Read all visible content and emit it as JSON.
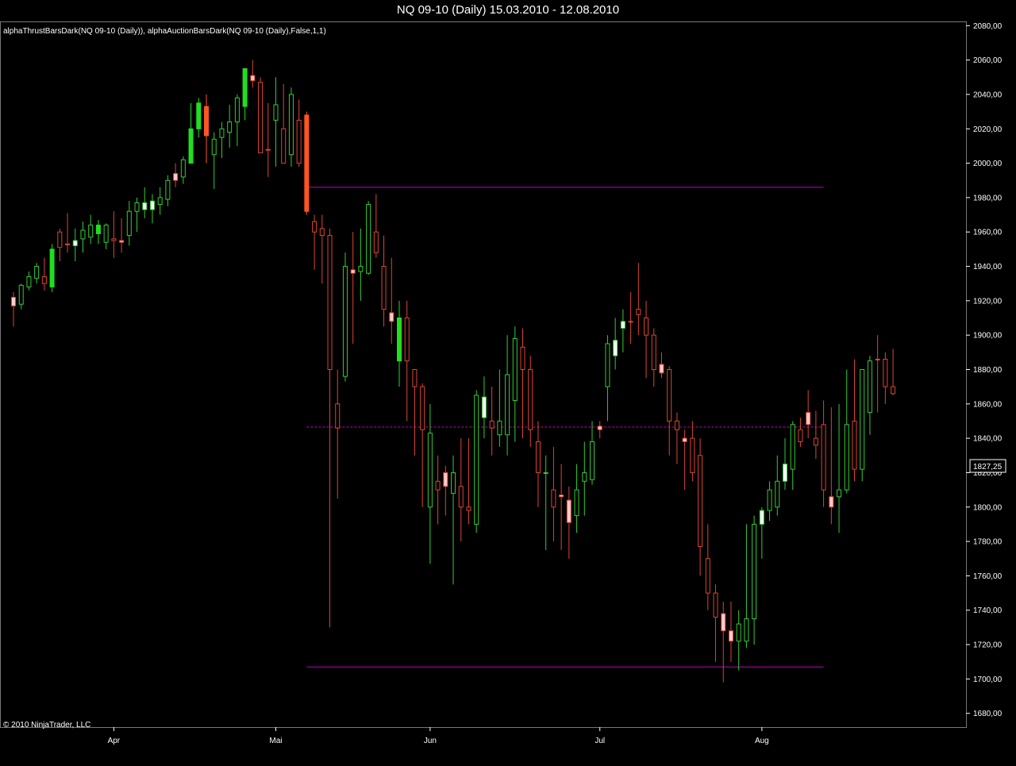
{
  "window": {
    "title": "NQ 09-10 (Daily)  15.03.2010 - 12.08.2010"
  },
  "chart_data": {
    "type": "candlestick",
    "indicator_label": "alphaThrustBarsDark(NQ 09-10 (Daily)), alphaAuctionBarsDark(NQ 09-10 (Daily),False,1,1)",
    "copyright": "© 2010 NinjaTrader, LLC",
    "price_label": "1827,25",
    "y_axis": {
      "min": 1672,
      "max": 2082,
      "ticks": [
        "2080,00",
        "2060,00",
        "2040,00",
        "2020,00",
        "2000,00",
        "1980,00",
        "1960,00",
        "1940,00",
        "1920,00",
        "1900,00",
        "1880,00",
        "1860,00",
        "1840,00",
        "1820,00",
        "1800,00",
        "1780,00",
        "1760,00",
        "1740,00",
        "1720,00",
        "1700,00",
        "1680,00"
      ]
    },
    "x_axis": {
      "labels": [
        {
          "label": "Apr",
          "index": 13
        },
        {
          "label": "Mai",
          "index": 34
        },
        {
          "label": "Jun",
          "index": 54
        },
        {
          "label": "Jul",
          "index": 76
        },
        {
          "label": "Aug",
          "index": 97
        }
      ]
    },
    "levels": [
      {
        "price": 1986,
        "from": 38,
        "to": 105,
        "style": "solid",
        "color": "#c000c0"
      },
      {
        "price": 1846.5,
        "from": 38,
        "to": 105,
        "style": "dashed",
        "color": "#c000c0"
      },
      {
        "price": 1707,
        "from": 38,
        "to": 105,
        "style": "solid",
        "color": "#c000c0"
      }
    ],
    "colors": {
      "thrust_up": "#22dd22",
      "thrust_down": "#ff5522",
      "up": "#33cc33",
      "down": "#dd4433",
      "neutral_up_fill": "#ffffff",
      "neutral_down_fill": "#ffcccc",
      "level": "#c000c0",
      "background": "#000000"
    },
    "candles": [
      {
        "o": 1917,
        "h": 1925,
        "l": 1905,
        "c": 1922,
        "t": "nd"
      },
      {
        "o": 1918,
        "h": 1930,
        "l": 1915,
        "c": 1929,
        "t": "u"
      },
      {
        "o": 1928,
        "h": 1937,
        "l": 1926,
        "c": 1934,
        "t": "u"
      },
      {
        "o": 1933,
        "h": 1942,
        "l": 1930,
        "c": 1940,
        "t": "u"
      },
      {
        "o": 1934,
        "h": 1945,
        "l": 1926,
        "c": 1930,
        "t": "d"
      },
      {
        "o": 1928,
        "h": 1953,
        "l": 1925,
        "c": 1950,
        "t": "tu"
      },
      {
        "o": 1951,
        "h": 1962,
        "l": 1943,
        "c": 1960,
        "t": "d"
      },
      {
        "o": 1953,
        "h": 1971,
        "l": 1948,
        "c": 1953,
        "t": "nd"
      },
      {
        "o": 1952,
        "h": 1962,
        "l": 1943,
        "c": 1955,
        "t": "nu"
      },
      {
        "o": 1956,
        "h": 1966,
        "l": 1948,
        "c": 1961,
        "t": "u"
      },
      {
        "o": 1957,
        "h": 1970,
        "l": 1953,
        "c": 1964,
        "t": "u"
      },
      {
        "o": 1964,
        "h": 1967,
        "l": 1953,
        "c": 1959,
        "t": "tu"
      },
      {
        "o": 1954,
        "h": 1965,
        "l": 1950,
        "c": 1964,
        "t": "u"
      },
      {
        "o": 1955,
        "h": 1972,
        "l": 1945,
        "c": 1956,
        "t": "d"
      },
      {
        "o": 1955,
        "h": 1968,
        "l": 1948,
        "c": 1954,
        "t": "nd"
      },
      {
        "o": 1958,
        "h": 1978,
        "l": 1952,
        "c": 1972,
        "t": "u"
      },
      {
        "o": 1972,
        "h": 1980,
        "l": 1960,
        "c": 1977,
        "t": "u"
      },
      {
        "o": 1977,
        "h": 1986,
        "l": 1968,
        "c": 1973,
        "t": "nu"
      },
      {
        "o": 1973,
        "h": 1982,
        "l": 1965,
        "c": 1978,
        "t": "nu"
      },
      {
        "o": 1976,
        "h": 1986,
        "l": 1970,
        "c": 1980,
        "t": "u"
      },
      {
        "o": 1979,
        "h": 1993,
        "l": 1975,
        "c": 1990,
        "t": "u"
      },
      {
        "o": 1990,
        "h": 2000,
        "l": 1986,
        "c": 1994,
        "t": "nd"
      },
      {
        "o": 1992,
        "h": 2004,
        "l": 1988,
        "c": 2002,
        "t": "u"
      },
      {
        "o": 2000,
        "h": 2035,
        "l": 2000,
        "c": 2020,
        "t": "tu"
      },
      {
        "o": 2020,
        "h": 2038,
        "l": 2015,
        "c": 2035,
        "t": "tu"
      },
      {
        "o": 2033,
        "h": 2040,
        "l": 2000,
        "c": 2016,
        "t": "td"
      },
      {
        "o": 2005,
        "h": 2018,
        "l": 1985,
        "c": 2014,
        "t": "u"
      },
      {
        "o": 2015,
        "h": 2024,
        "l": 2003,
        "c": 2020,
        "t": "u"
      },
      {
        "o": 2018,
        "h": 2034,
        "l": 2009,
        "c": 2024,
        "t": "u"
      },
      {
        "o": 2024,
        "h": 2040,
        "l": 2010,
        "c": 2038,
        "t": "u"
      },
      {
        "o": 2033,
        "h": 2055,
        "l": 2025,
        "c": 2055,
        "t": "tu"
      },
      {
        "o": 2051,
        "h": 2060,
        "l": 2044,
        "c": 2048,
        "t": "nd"
      },
      {
        "o": 2047,
        "h": 2050,
        "l": 2025,
        "c": 2006,
        "t": "d"
      },
      {
        "o": 2008,
        "h": 2035,
        "l": 1992,
        "c": 2008,
        "t": "nd"
      },
      {
        "o": 2025,
        "h": 2050,
        "l": 1998,
        "c": 2034,
        "t": "u"
      },
      {
        "o": 2020,
        "h": 2046,
        "l": 2000,
        "c": 2000,
        "t": "d"
      },
      {
        "o": 2005,
        "h": 2044,
        "l": 1998,
        "c": 2040,
        "t": "u"
      },
      {
        "o": 2025,
        "h": 2037,
        "l": 1998,
        "c": 2000,
        "t": "d"
      },
      {
        "o": 2028,
        "h": 2030,
        "l": 1970,
        "c": 1972,
        "t": "td"
      },
      {
        "o": 1966,
        "h": 1970,
        "l": 1938,
        "c": 1960,
        "t": "d"
      },
      {
        "o": 1962,
        "h": 1970,
        "l": 1930,
        "c": 1958,
        "t": "d"
      },
      {
        "o": 1958,
        "h": 1962,
        "l": 1730,
        "c": 1880,
        "t": "d"
      },
      {
        "o": 1860,
        "h": 1880,
        "l": 1805,
        "c": 1846,
        "t": "d"
      },
      {
        "o": 1876,
        "h": 1948,
        "l": 1873,
        "c": 1940,
        "t": "u"
      },
      {
        "o": 1938,
        "h": 1960,
        "l": 1895,
        "c": 1936,
        "t": "nd"
      },
      {
        "o": 1940,
        "h": 1962,
        "l": 1920,
        "c": 1937,
        "t": "u"
      },
      {
        "o": 1936,
        "h": 1978,
        "l": 1935,
        "c": 1976,
        "t": "u"
      },
      {
        "o": 1960,
        "h": 1982,
        "l": 1945,
        "c": 1948,
        "t": "d"
      },
      {
        "o": 1940,
        "h": 1958,
        "l": 1905,
        "c": 1915,
        "t": "d"
      },
      {
        "o": 1913,
        "h": 1945,
        "l": 1895,
        "c": 1908,
        "t": "nd"
      },
      {
        "o": 1910,
        "h": 1920,
        "l": 1870,
        "c": 1885,
        "t": "tu"
      },
      {
        "o": 1910,
        "h": 1920,
        "l": 1850,
        "c": 1885,
        "t": "d"
      },
      {
        "o": 1880,
        "h": 1880,
        "l": 1830,
        "c": 1870,
        "t": "d"
      },
      {
        "o": 1870,
        "h": 1872,
        "l": 1800,
        "c": 1845,
        "t": "d"
      },
      {
        "o": 1843,
        "h": 1860,
        "l": 1767,
        "c": 1800,
        "t": "u"
      },
      {
        "o": 1815,
        "h": 1830,
        "l": 1790,
        "c": 1810,
        "t": "d"
      },
      {
        "o": 1812,
        "h": 1824,
        "l": 1795,
        "c": 1820,
        "t": "nd"
      },
      {
        "o": 1820,
        "h": 1830,
        "l": 1755,
        "c": 1808,
        "t": "u"
      },
      {
        "o": 1812,
        "h": 1840,
        "l": 1780,
        "c": 1800,
        "t": "d"
      },
      {
        "o": 1800,
        "h": 1840,
        "l": 1790,
        "c": 1798,
        "t": "d"
      },
      {
        "o": 1790,
        "h": 1868,
        "l": 1785,
        "c": 1865,
        "t": "u"
      },
      {
        "o": 1864,
        "h": 1876,
        "l": 1840,
        "c": 1852,
        "t": "nu"
      },
      {
        "o": 1850,
        "h": 1870,
        "l": 1830,
        "c": 1846,
        "t": "d"
      },
      {
        "o": 1850,
        "h": 1880,
        "l": 1835,
        "c": 1842,
        "t": "u"
      },
      {
        "o": 1842,
        "h": 1900,
        "l": 1830,
        "c": 1877,
        "t": "u"
      },
      {
        "o": 1862,
        "h": 1905,
        "l": 1838,
        "c": 1898,
        "t": "u"
      },
      {
        "o": 1893,
        "h": 1904,
        "l": 1840,
        "c": 1880,
        "t": "d"
      },
      {
        "o": 1880,
        "h": 1888,
        "l": 1835,
        "c": 1845,
        "t": "d"
      },
      {
        "o": 1838,
        "h": 1850,
        "l": 1800,
        "c": 1820,
        "t": "d"
      },
      {
        "o": 1820,
        "h": 1830,
        "l": 1775,
        "c": 1820,
        "t": "u"
      },
      {
        "o": 1810,
        "h": 1835,
        "l": 1780,
        "c": 1800,
        "t": "d"
      },
      {
        "o": 1807,
        "h": 1825,
        "l": 1775,
        "c": 1806,
        "t": "nd"
      },
      {
        "o": 1804,
        "h": 1812,
        "l": 1770,
        "c": 1791,
        "t": "nd"
      },
      {
        "o": 1795,
        "h": 1825,
        "l": 1785,
        "c": 1810,
        "t": "u"
      },
      {
        "o": 1820,
        "h": 1838,
        "l": 1795,
        "c": 1815,
        "t": "u"
      },
      {
        "o": 1816,
        "h": 1850,
        "l": 1813,
        "c": 1838,
        "t": "u"
      },
      {
        "o": 1845,
        "h": 1850,
        "l": 1840,
        "c": 1847,
        "t": "nd"
      },
      {
        "o": 1870,
        "h": 1900,
        "l": 1850,
        "c": 1895,
        "t": "u"
      },
      {
        "o": 1897,
        "h": 1910,
        "l": 1880,
        "c": 1888,
        "t": "nu"
      },
      {
        "o": 1908,
        "h": 1915,
        "l": 1890,
        "c": 1904,
        "t": "nu"
      },
      {
        "o": 1908,
        "h": 1925,
        "l": 1895,
        "c": 1908,
        "t": "d"
      },
      {
        "o": 1912,
        "h": 1942,
        "l": 1900,
        "c": 1915,
        "t": "d"
      },
      {
        "o": 1910,
        "h": 1920,
        "l": 1875,
        "c": 1900,
        "t": "d"
      },
      {
        "o": 1900,
        "h": 1904,
        "l": 1870,
        "c": 1880,
        "t": "d"
      },
      {
        "o": 1883,
        "h": 1890,
        "l": 1875,
        "c": 1878,
        "t": "nd"
      },
      {
        "o": 1880,
        "h": 1882,
        "l": 1830,
        "c": 1850,
        "t": "d"
      },
      {
        "o": 1850,
        "h": 1855,
        "l": 1825,
        "c": 1845,
        "t": "d"
      },
      {
        "o": 1840,
        "h": 1845,
        "l": 1810,
        "c": 1838,
        "t": "nd"
      },
      {
        "o": 1840,
        "h": 1850,
        "l": 1815,
        "c": 1820,
        "t": "d"
      },
      {
        "o": 1830,
        "h": 1840,
        "l": 1760,
        "c": 1777,
        "t": "d"
      },
      {
        "o": 1770,
        "h": 1790,
        "l": 1740,
        "c": 1750,
        "t": "d"
      },
      {
        "o": 1750,
        "h": 1755,
        "l": 1710,
        "c": 1736,
        "t": "d"
      },
      {
        "o": 1738,
        "h": 1745,
        "l": 1698,
        "c": 1728,
        "t": "nd"
      },
      {
        "o": 1728,
        "h": 1745,
        "l": 1710,
        "c": 1722,
        "t": "nd"
      },
      {
        "o": 1722,
        "h": 1740,
        "l": 1705,
        "c": 1732,
        "t": "u"
      },
      {
        "o": 1722,
        "h": 1790,
        "l": 1718,
        "c": 1735,
        "t": "u"
      },
      {
        "o": 1735,
        "h": 1795,
        "l": 1720,
        "c": 1790,
        "t": "u"
      },
      {
        "o": 1790,
        "h": 1800,
        "l": 1770,
        "c": 1798,
        "t": "nu"
      },
      {
        "o": 1798,
        "h": 1815,
        "l": 1792,
        "c": 1810,
        "t": "u"
      },
      {
        "o": 1800,
        "h": 1830,
        "l": 1795,
        "c": 1815,
        "t": "u"
      },
      {
        "o": 1815,
        "h": 1840,
        "l": 1810,
        "c": 1825,
        "t": "nu"
      },
      {
        "o": 1822,
        "h": 1850,
        "l": 1810,
        "c": 1848,
        "t": "u"
      },
      {
        "o": 1845,
        "h": 1852,
        "l": 1835,
        "c": 1838,
        "t": "d"
      },
      {
        "o": 1855,
        "h": 1868,
        "l": 1840,
        "c": 1848,
        "t": "nd"
      },
      {
        "o": 1840,
        "h": 1856,
        "l": 1828,
        "c": 1836,
        "t": "d"
      },
      {
        "o": 1848,
        "h": 1862,
        "l": 1800,
        "c": 1810,
        "t": "d"
      },
      {
        "o": 1800,
        "h": 1858,
        "l": 1790,
        "c": 1806,
        "t": "nd"
      },
      {
        "o": 1810,
        "h": 1860,
        "l": 1785,
        "c": 1806,
        "t": "u"
      },
      {
        "o": 1810,
        "h": 1880,
        "l": 1808,
        "c": 1848,
        "t": "u"
      },
      {
        "o": 1850,
        "h": 1886,
        "l": 1815,
        "c": 1822,
        "t": "d"
      },
      {
        "o": 1822,
        "h": 1880,
        "l": 1815,
        "c": 1880,
        "t": "u"
      },
      {
        "o": 1855,
        "h": 1888,
        "l": 1842,
        "c": 1885,
        "t": "u"
      },
      {
        "o": 1886,
        "h": 1900,
        "l": 1855,
        "c": 1886,
        "t": "nd"
      },
      {
        "o": 1886,
        "h": 1890,
        "l": 1860,
        "c": 1870,
        "t": "d"
      },
      {
        "o": 1870,
        "h": 1892,
        "l": 1865,
        "c": 1866,
        "t": "d"
      }
    ]
  }
}
